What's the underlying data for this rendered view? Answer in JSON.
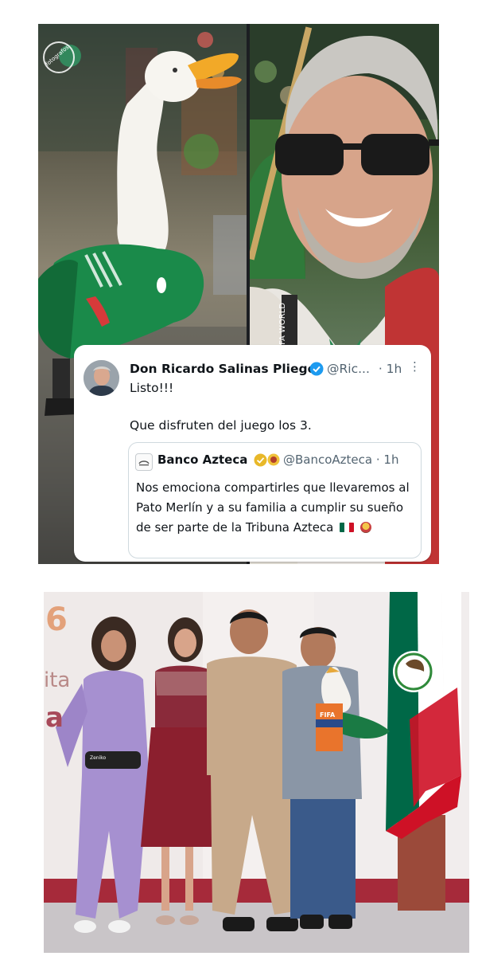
{
  "top_photo": {
    "watermark": "fotografos",
    "jersey_text": "FIFA WORLD"
  },
  "tweet": {
    "author_name": "Don Ricardo Salinas Pliego",
    "handle": "@Ric...",
    "time": "· 1h",
    "more_symbol": "⋮",
    "text_line1": "Listo!!!",
    "text_line2": "Que disfruten del juego los 3.",
    "quote": {
      "author_name": "Banco Azteca",
      "handle": "@BancoAzteca · 1h",
      "body": "Nos emociona compartirles que llevaremos al Pato Merlín y a su familia a cumplir su sueño de ser parte de la Tribuna Azteca"
    }
  },
  "bottom_photo": {
    "backdrop_number": "6",
    "backdrop_text_1": "ita",
    "backdrop_text_2": "a",
    "bag_text": "Zeniko",
    "scarf_text": "FIFA"
  },
  "colors": {
    "verified_blue": "#1d9bf0",
    "verified_gold": "#e8b829",
    "text_primary": "#0f1419",
    "text_secondary": "#536471",
    "mexico_green": "#006847",
    "mexico_red": "#ce1126"
  }
}
